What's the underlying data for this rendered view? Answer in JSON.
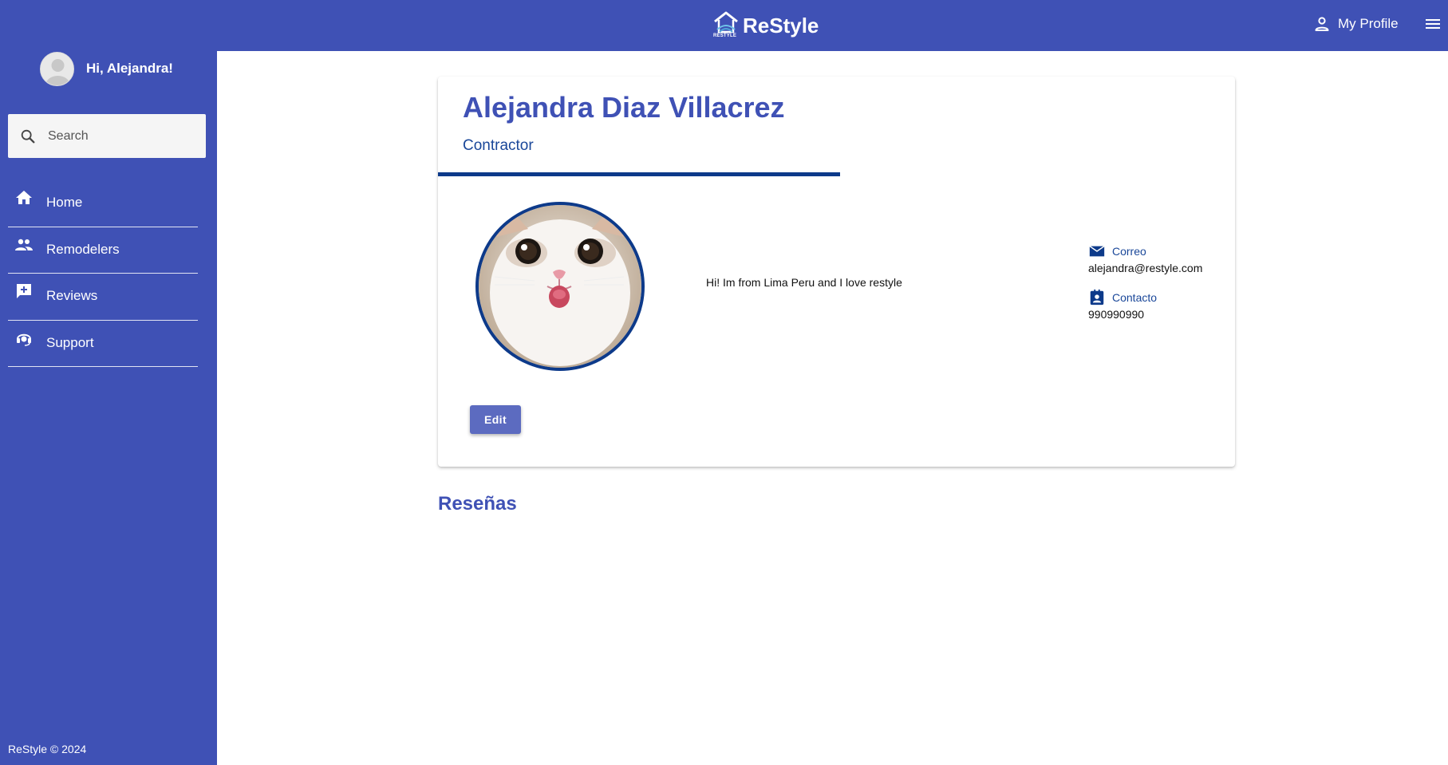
{
  "header": {
    "brand_name": "ReStyle",
    "brand_logo_text": "RESTYLE",
    "profile_label": "My Profile"
  },
  "sidebar": {
    "greeting": "Hi, Alejandra!",
    "search_placeholder": "Search",
    "items": [
      {
        "label": "Home",
        "icon": "home-icon"
      },
      {
        "label": "Remodelers",
        "icon": "people-icon"
      },
      {
        "label": "Reviews",
        "icon": "add-comment-icon"
      },
      {
        "label": "Support",
        "icon": "support-agent-icon"
      }
    ],
    "footer": "ReStyle © 2024"
  },
  "profile": {
    "name": "Alejandra Diaz Villacrez",
    "role": "Contractor",
    "bio": "Hi! Im from Lima Peru and I love restyle",
    "email_label": "Correo",
    "email": "alejandra@restyle.com",
    "contact_label": "Contacto",
    "phone": "990990990",
    "edit_label": "Edit"
  },
  "reviews": {
    "title": "Reseñas"
  },
  "colors": {
    "primary": "#3f51b5",
    "accent_dark": "#0d3a8a",
    "button": "#5c6bc0"
  }
}
